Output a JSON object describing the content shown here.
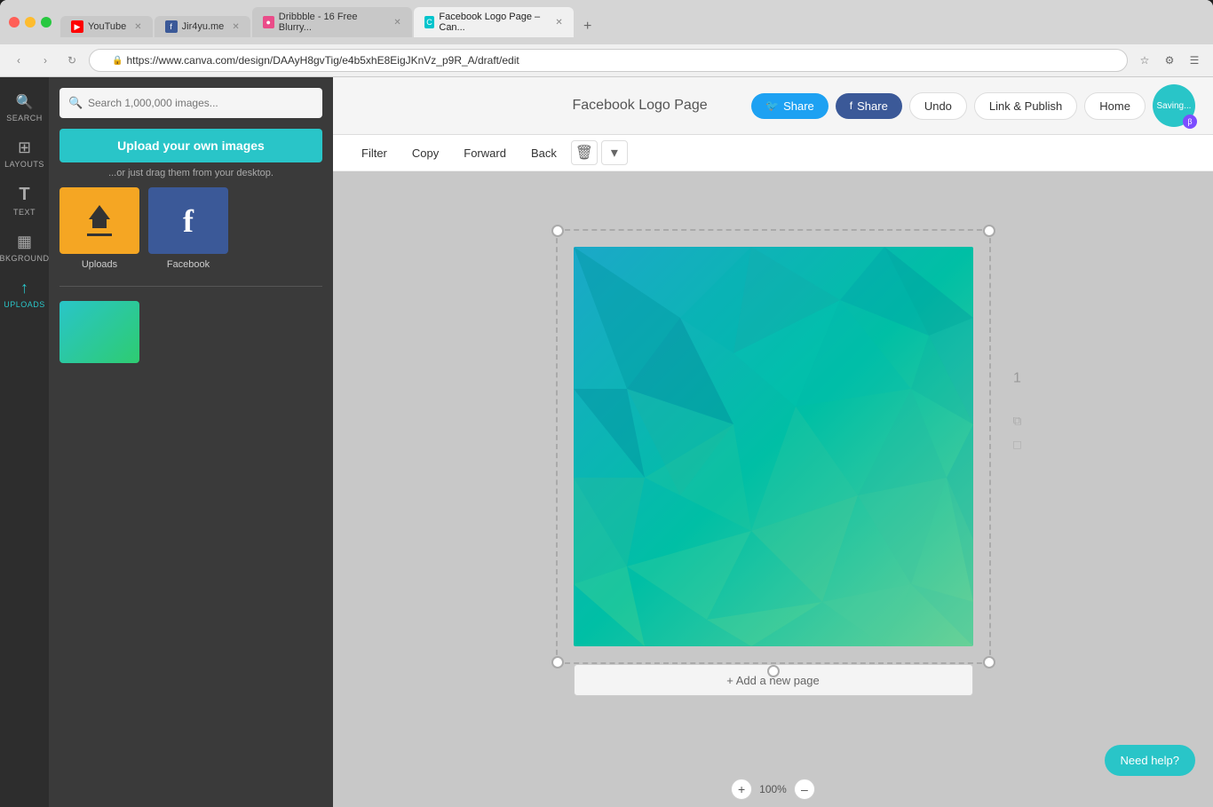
{
  "browser": {
    "tabs": [
      {
        "id": "youtube",
        "label": "YouTube",
        "favicon_type": "yt",
        "favicon_char": "▶",
        "active": false
      },
      {
        "id": "jir4yu",
        "label": "Jir4yu.me",
        "favicon_type": "fb",
        "favicon_char": "f",
        "active": false
      },
      {
        "id": "dribbble",
        "label": "Dribbble - 16 Free Blurry...",
        "favicon_type": "dr",
        "favicon_char": "◉",
        "active": false
      },
      {
        "id": "canva",
        "label": "Facebook Logo Page – Can...",
        "favicon_type": "canva",
        "favicon_char": "C",
        "active": true
      }
    ],
    "address": "https://www.canva.com/design/DAAyH8gvTig/e4b5xhE8EigJKnVz_p9R_A/draft/edit"
  },
  "sidebar": {
    "items": [
      {
        "id": "search",
        "icon": "🔍",
        "label": "SEARCH",
        "active": false
      },
      {
        "id": "layouts",
        "icon": "⊞",
        "label": "LAYOUTS",
        "active": false
      },
      {
        "id": "text",
        "icon": "T",
        "label": "TEXT",
        "active": false
      },
      {
        "id": "bkground",
        "icon": "≋",
        "label": "BKGROUND",
        "active": false
      },
      {
        "id": "uploads",
        "icon": "↑",
        "label": "UPLOADS",
        "active": true
      }
    ]
  },
  "panel": {
    "search_placeholder": "Search 1,000,000 images...",
    "upload_btn_label": "Upload your own images",
    "drag_hint": "...or just drag them from your desktop.",
    "sources": [
      {
        "id": "uploads",
        "label": "Uploads",
        "type": "uploads"
      },
      {
        "id": "facebook",
        "label": "Facebook",
        "type": "facebook"
      }
    ]
  },
  "canvas": {
    "title": "Facebook Logo Page",
    "actions": {
      "twitter_share": "Share",
      "facebook_share": "Share",
      "undo": "Undo",
      "link_publish": "Link & Publish",
      "home": "Home",
      "saving": "Saving..."
    },
    "toolbar": {
      "filter": "Filter",
      "copy": "Copy",
      "forward": "Forward",
      "back": "Back"
    },
    "page_number": "1",
    "add_page": "+ Add a new page"
  },
  "footer": {
    "zoom_plus": "+",
    "zoom_level": "100%",
    "zoom_minus": "–"
  },
  "help": {
    "label": "Need help?"
  }
}
